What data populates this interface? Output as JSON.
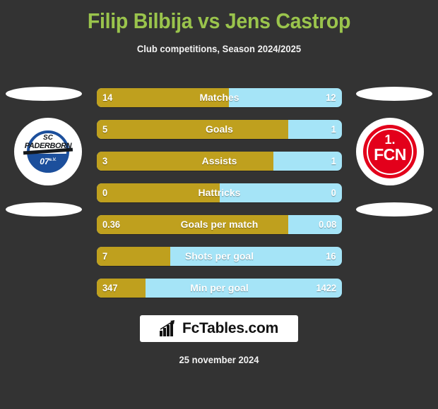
{
  "header": {
    "title": "Filip Bilbija vs Jens Castrop",
    "subtitle": "Club competitions, Season 2024/2025",
    "title_color": "#9ac44c"
  },
  "teams": {
    "left": {
      "name": "SC Paderborn 07",
      "crest_line1": "SC",
      "crest_line2": "PADERBORN",
      "crest_line3": "07",
      "crest_suffix": "e.V.",
      "color": "#1c4f9c"
    },
    "right": {
      "name": "1. FCN",
      "crest_line1": "1.",
      "crest_line2": "FCN",
      "color": "#e3001b"
    }
  },
  "legend": {
    "left_color": "#bfa01e",
    "right_color": "#a5e4f7"
  },
  "chart_data": {
    "type": "bar",
    "title": "Filip Bilbija vs Jens Castrop",
    "subtitle": "Club competitions, Season 2024/2025",
    "xlabel": "",
    "ylabel": "",
    "series": [
      {
        "name": "Filip Bilbija",
        "color": "#bfa01e",
        "values": [
          14,
          5,
          3,
          0,
          0.36,
          7,
          347
        ]
      },
      {
        "name": "Jens Castrop",
        "color": "#a5e4f7",
        "values": [
          12,
          1,
          1,
          0,
          0.08,
          16,
          1422
        ]
      }
    ],
    "categories": [
      "Matches",
      "Goals",
      "Assists",
      "Hattricks",
      "Goals per match",
      "Shots per goal",
      "Min per goal"
    ],
    "rows": [
      {
        "label": "Matches",
        "left": "14",
        "right": "12",
        "left_pct": 54
      },
      {
        "label": "Goals",
        "left": "5",
        "right": "1",
        "left_pct": 78
      },
      {
        "label": "Assists",
        "left": "3",
        "right": "1",
        "left_pct": 72
      },
      {
        "label": "Hattricks",
        "left": "0",
        "right": "0",
        "left_pct": 50
      },
      {
        "label": "Goals per match",
        "left": "0.36",
        "right": "0.08",
        "left_pct": 78
      },
      {
        "label": "Shots per goal",
        "left": "7",
        "right": "16",
        "left_pct": 30
      },
      {
        "label": "Min per goal",
        "left": "347",
        "right": "1422",
        "left_pct": 20
      }
    ]
  },
  "footer": {
    "brand": "FcTables.com",
    "brand_icon": "bar-chart-growth-icon",
    "date": "25 november 2024"
  }
}
